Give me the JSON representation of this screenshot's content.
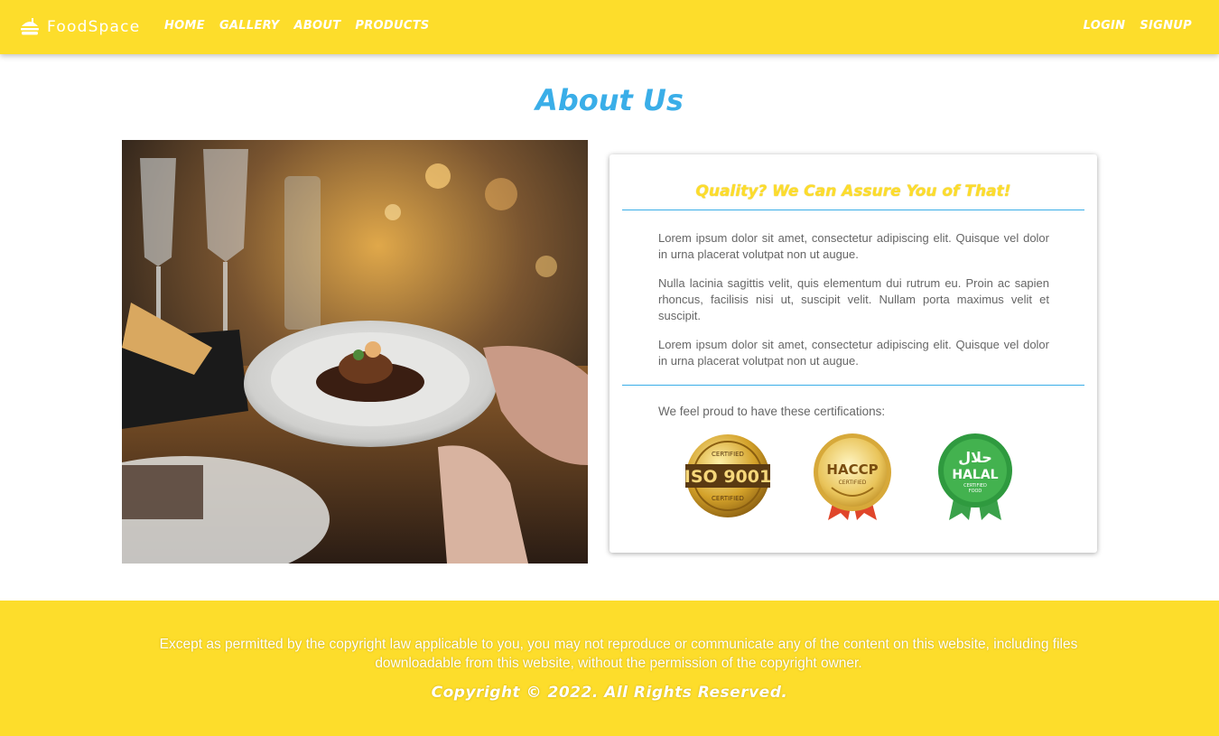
{
  "nav": {
    "brand": "FoodSpace",
    "brand_icon": "burger-icon",
    "links": [
      "HOME",
      "GALLERY",
      "ABOUT",
      "PRODUCTS"
    ],
    "login": "LOGIN",
    "signup": "SIGNUP"
  },
  "page": {
    "title": "About Us"
  },
  "about_card": {
    "heading": "Quality? We Can Assure You of That!",
    "paragraphs": [
      "Lorem ipsum dolor sit amet, consectetur adipiscing elit. Quisque vel dolor in urna placerat volutpat non ut augue.",
      "Nulla lacinia sagittis velit, quis elementum dui rutrum eu. Proin ac sapien rhoncus, facilisis nisi ut, suscipit velit. Nullam porta maximus velit et suscipit.",
      "Lorem ipsum dolor sit amet, consectetur adipiscing elit. Quisque vel dolor in urna placerat volutpat non ut augue."
    ],
    "cert_intro": "We feel proud to have these certifications:",
    "badges": {
      "iso": {
        "top": "CERTIFIED",
        "main": "ISO 9001",
        "bottom": "CERTIFIED"
      },
      "haccp": {
        "main": "HACCP",
        "sub": "CERTIFIED"
      },
      "halal": {
        "arabic": "حلال",
        "main": "HALAL",
        "sub1": "CERTIFIED",
        "sub2": "FOOD"
      }
    }
  },
  "footer": {
    "notice": "Except as permitted by the copyright law applicable to you, you may not reproduce or communicate any of the content on this website, including files downloadable from this website, without the permission of the copyright owner.",
    "copyright": "Copyright © 2022. All Rights Reserved."
  },
  "colors": {
    "brand_yellow": "#fddd2b",
    "accent_blue": "#3aaee8",
    "text_gray": "#666666"
  }
}
